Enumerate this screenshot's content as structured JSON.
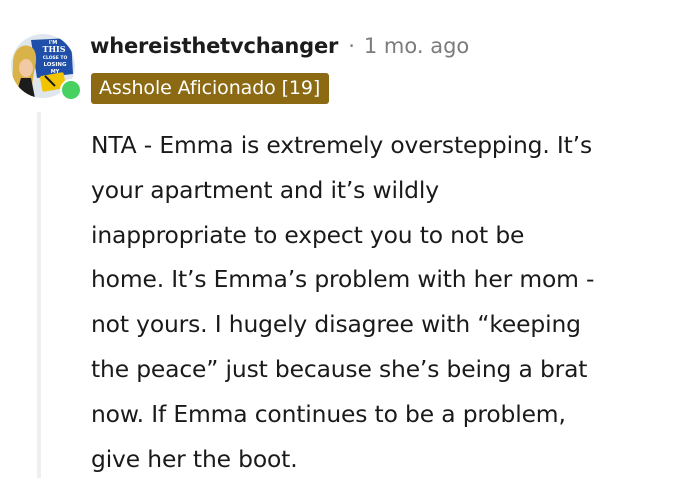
{
  "comment": {
    "username": "whereisthetvchanger",
    "separator": "·",
    "timestamp": "1 mo. ago",
    "flair": "Asshole Aficionado [19]",
    "avatar_text": [
      "I'M",
      "THIS",
      "CLOSE TO",
      "LOSING",
      "MY"
    ],
    "body_lines": [
      "NTA - Emma is extremely overstepping. It’s",
      "your apartment and it’s wildly",
      "inappropriate to expect you to not be",
      "home. It’s Emma’s problem with her mom -",
      "not yours. I hugely disagree with “keeping",
      "the peace” just because she’s being a brat",
      "now. If Emma continues to be a problem,",
      "give her the boot."
    ]
  },
  "colors": {
    "flair_bg": "#8c6a13",
    "online_indicator": "#46d160",
    "thread_line": "#edeff1",
    "meta_text": "#7c7c7c"
  }
}
